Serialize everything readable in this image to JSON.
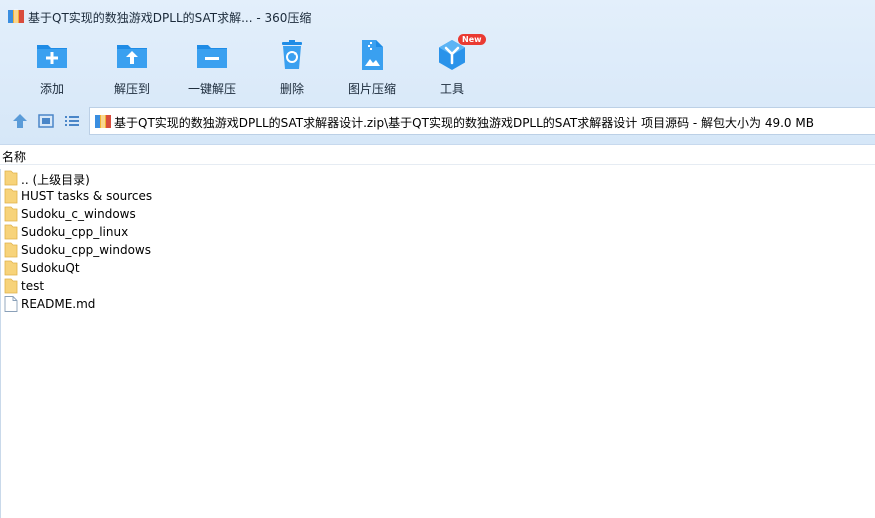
{
  "window": {
    "title": "基于QT实现的数独游戏DPLL的SAT求解... - 360压缩"
  },
  "toolbar": {
    "items": [
      {
        "label": "添加",
        "icon": "add-icon"
      },
      {
        "label": "解压到",
        "icon": "extract-to-icon"
      },
      {
        "label": "一键解压",
        "icon": "one-click-extract-icon"
      },
      {
        "label": "删除",
        "icon": "recycle-delete-icon"
      },
      {
        "label": "图片压缩",
        "icon": "image-compress-icon"
      },
      {
        "label": "工具",
        "icon": "tools-icon",
        "badge": "New"
      }
    ]
  },
  "nav": {
    "buttons": [
      "up-arrow-icon",
      "thumbnail-view-icon",
      "list-view-icon"
    ],
    "path": "基于QT实现的数独游戏DPLL的SAT求解器设计.zip\\基于QT实现的数独游戏DPLL的SAT求解器设计 项目源码 - 解包大小为 49.0 MB"
  },
  "list": {
    "column_name": "名称",
    "items": [
      {
        "name": ".. (上级目录)",
        "type": "folder"
      },
      {
        "name": "HUST tasks &  sources",
        "type": "folder"
      },
      {
        "name": "Sudoku_c_windows",
        "type": "folder"
      },
      {
        "name": "Sudoku_cpp_linux",
        "type": "folder"
      },
      {
        "name": "Sudoku_cpp_windows",
        "type": "folder"
      },
      {
        "name": "SudokuQt",
        "type": "folder"
      },
      {
        "name": "test",
        "type": "folder"
      },
      {
        "name": "README.md",
        "type": "file"
      }
    ]
  },
  "colors": {
    "accent": "#1f8ce6",
    "folder": "#f7d37a",
    "badge": "#ea3a32"
  }
}
